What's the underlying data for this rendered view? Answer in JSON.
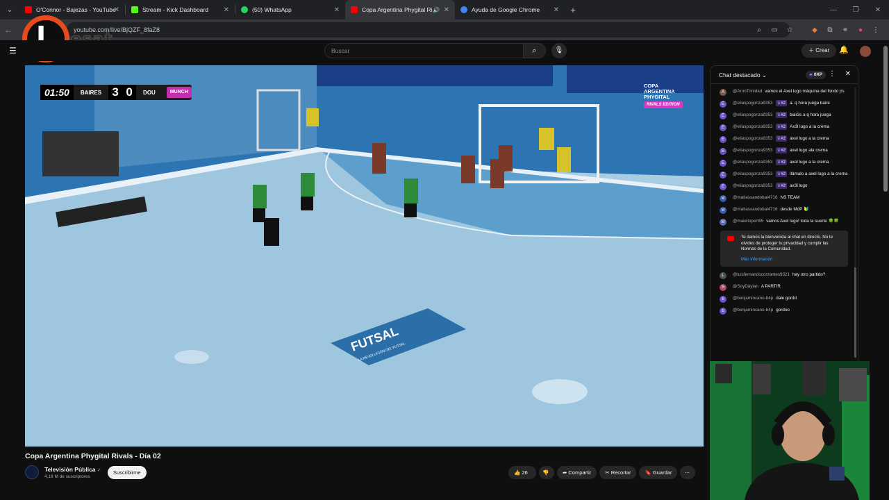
{
  "browser": {
    "tabs": [
      {
        "label": "O'Connor - Bajezas - YouTube",
        "favicon_color": "#ff0000"
      },
      {
        "label": "Stream - Kick Dashboard",
        "favicon_color": "#53fc18"
      },
      {
        "label": "(50) WhatsApp",
        "favicon_color": "#25d366"
      },
      {
        "label": "Copa Argentina Phygital Ri",
        "favicon_color": "#ff0000"
      },
      {
        "label": "Ayuda de Google Chrome",
        "favicon_color": "#4285f4"
      }
    ],
    "url": "youtube.com/live/BjQZF_8faZ8"
  },
  "logo": {
    "letter": "I",
    "text": "esat"
  },
  "youtube": {
    "search_placeholder": "Buscar",
    "create_label": "Crear"
  },
  "video": {
    "scoreboard": {
      "clock": "01:50",
      "home": "BAIRES",
      "home_score": "3",
      "away_score": "0",
      "away": "DOU",
      "brand": "MUNCH"
    },
    "badge": {
      "line1": "COPA",
      "line2": "ARGENTINA",
      "line3": "PHYGITAL",
      "edition": "RIVALS EDITION"
    },
    "floor_logo": "FUTSAL",
    "floor_tagline": "LA REVOLUCIÓN DEL FUTSAL",
    "title": "Copa Argentina Phygital Rivals - Día 02",
    "channel": "Televisión Pública",
    "subscribers": "4,18 M de suscriptores",
    "subscribe_label": "Suscribirme",
    "likes": "26",
    "share_label": "Compartir",
    "clip_label": "Recortar",
    "save_label": "Guardar"
  },
  "chat": {
    "title": "Chat destacado",
    "xp": "0XP",
    "messages": [
      {
        "author": "@AronTrinidad",
        "badge": "",
        "text": "vamos el Axel lugo máquina del fondo jrs",
        "avatar_color": "#7a5a4a",
        "initial": "A"
      },
      {
        "author": "@eliaspogonza9353",
        "badge": "♕#2",
        "text": "a. q hora juega baire",
        "avatar_color": "#6f52c5",
        "initial": "E"
      },
      {
        "author": "@eliaspogonza9353",
        "badge": "♕#2",
        "text": "bair3s a q hora juega",
        "avatar_color": "#6f52c5",
        "initial": "E"
      },
      {
        "author": "@eliaspogonza9353",
        "badge": "♕#2",
        "text": "Ax3l lugo a la crema",
        "avatar_color": "#6f52c5",
        "initial": "E"
      },
      {
        "author": "@eliaspogonza9353",
        "badge": "♕#2",
        "text": "axel lugo a la crema",
        "avatar_color": "#6f52c5",
        "initial": "E"
      },
      {
        "author": "@eliaspogonza9353",
        "badge": "♕#2",
        "text": "axel lugo ala crema",
        "avatar_color": "#6f52c5",
        "initial": "E"
      },
      {
        "author": "@eliaspogonza9353",
        "badge": "♕#2",
        "text": "axel lugo a la crema",
        "avatar_color": "#6f52c5",
        "initial": "E"
      },
      {
        "author": "@eliaspogonza9353",
        "badge": "♕#2",
        "text": "llámalo a axel lugo a la crema",
        "avatar_color": "#6f52c5",
        "initial": "E"
      },
      {
        "author": "@eliaspogonza9353",
        "badge": "♕#2",
        "text": "ax3l lugo",
        "avatar_color": "#6f52c5",
        "initial": "E"
      },
      {
        "author": "@matiassandobal4716",
        "badge": "",
        "text": "NS TEAM",
        "avatar_color": "#3b5bb0",
        "initial": "M"
      },
      {
        "author": "@matiassandobal4716",
        "badge": "",
        "text": "desde MdP 🔰",
        "avatar_color": "#3b5bb0",
        "initial": "M"
      },
      {
        "author": "@maiellopert65",
        "badge": "",
        "text": "vamos Axel lugo! toda la suerte 🍀🍀",
        "avatar_color": "#5a6aa8",
        "initial": "M"
      }
    ],
    "welcome": {
      "text": "Te damos la bienvenida al chat en directo. No te olvides de proteger tu privacidad y cumplir las Normas de la Comunidad.",
      "link": "Más información"
    },
    "messages_after": [
      {
        "author": "@luisfernandocorzantes9321",
        "badge": "",
        "text": "hay otro partido?",
        "avatar_color": "#4a5a4a",
        "initial": "L"
      },
      {
        "author": "@SoyDaylan",
        "badge": "",
        "text": "A PARTIR",
        "avatar_color": "#b04a6a",
        "initial": "S"
      },
      {
        "author": "@benjamincano-b4p",
        "badge": "",
        "text": "dale gordd",
        "avatar_color": "#6f52c5",
        "initial": "b"
      },
      {
        "author": "@benjamincano-b4p",
        "badge": "",
        "text": "gordoo",
        "avatar_color": "#6f52c5",
        "initial": "b"
      }
    ]
  },
  "colors": {
    "accent": "#ff0000",
    "logo_ring": "#e84a1f",
    "court": "#9cc3dc",
    "brand_pink": "#c32fae"
  }
}
